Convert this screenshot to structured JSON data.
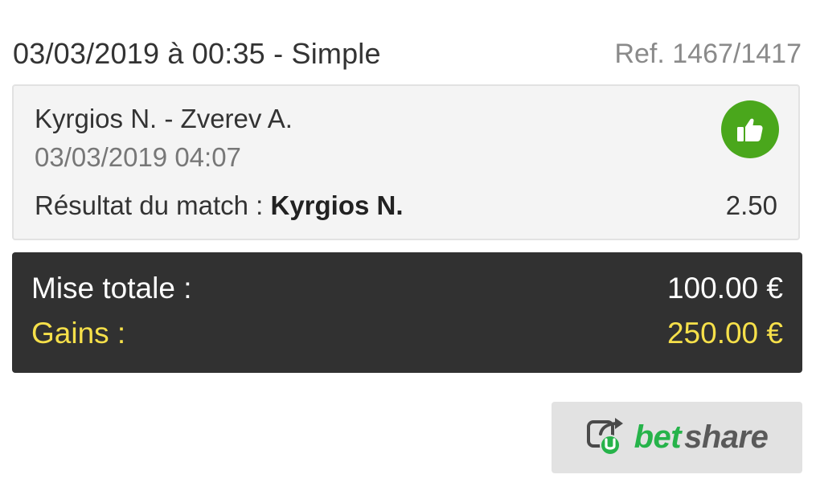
{
  "header": {
    "title": "03/03/2019 à 00:35 - Simple",
    "reference": "Ref. 1467/1417"
  },
  "bet": {
    "match": "Kyrgios N. - Zverev A.",
    "datetime": "03/03/2019 04:07",
    "market_label": "Résultat du match : ",
    "selection": "Kyrgios N.",
    "odds": "2.50",
    "status_icon": "thumbs-up-icon",
    "status_color": "#4aa71c"
  },
  "summary": {
    "stake_label": "Mise totale :",
    "stake_value": "100.00 €",
    "gains_label": "Gains :",
    "gains_value": "250.00 €",
    "gains_color": "#f6e04a"
  },
  "betshare": {
    "icon": "betshare-share-icon",
    "text_bet": "bet",
    "text_share": "share",
    "bet_color": "#26b34a"
  }
}
